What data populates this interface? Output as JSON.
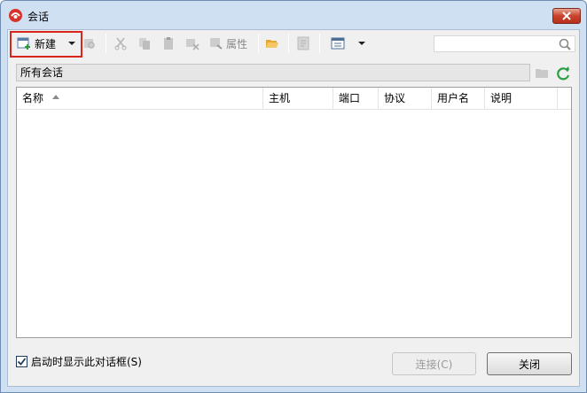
{
  "window": {
    "title": "会话"
  },
  "toolbar": {
    "new_label": "新建",
    "properties_label": "属性",
    "search": {
      "value": "",
      "placeholder": ""
    }
  },
  "pathbar": {
    "text": "所有会话"
  },
  "table": {
    "columns": [
      "名称",
      "主机",
      "端口",
      "协议",
      "用户名",
      "说明"
    ],
    "rows": []
  },
  "footer": {
    "show_on_startup_label": "启动时显示此对话框(S)",
    "show_on_startup_checked": true,
    "connect_label": "连接(C)",
    "close_label": "关闭"
  },
  "colors": {
    "highlight_border": "#d9261c",
    "refresh_green": "#2ea043",
    "title_bar": "#cfe0f2"
  }
}
